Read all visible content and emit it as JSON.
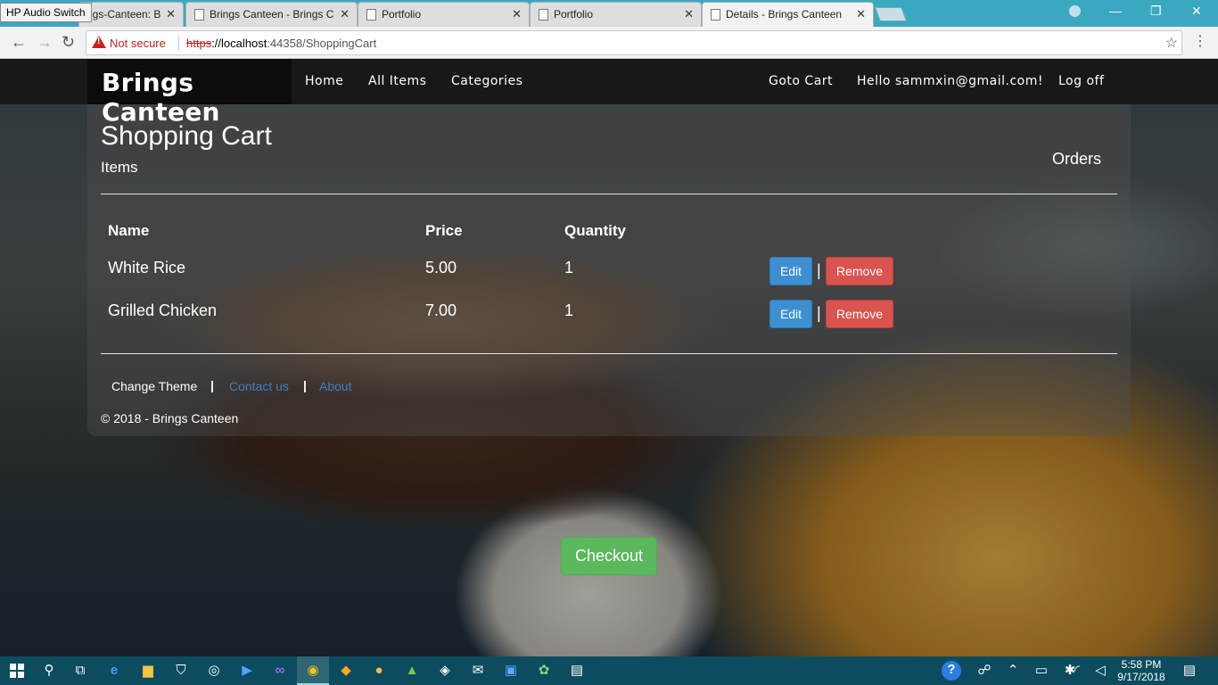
{
  "browser": {
    "hp_label": "HP Audio Switch",
    "tabs": [
      {
        "title": "ngs-Canteen: B",
        "active": false
      },
      {
        "title": "Brings Canteen - Brings C",
        "active": false
      },
      {
        "title": "Portfolio",
        "active": false
      },
      {
        "title": "Portfolio",
        "active": false
      },
      {
        "title": "Details - Brings Canteen",
        "active": true
      }
    ],
    "close_glyph": "✕",
    "security_label": "Not secure",
    "url_scheme": "https",
    "url_host": "://localhost",
    "url_rest": ":44358/ShoppingCart",
    "icons": [
      "back-icon",
      "forward-icon",
      "reload-icon",
      "warning-icon",
      "star-icon",
      "menu-icon"
    ]
  },
  "site": {
    "brand": "Brings Canteen",
    "nav_left": [
      "Home",
      "All Items",
      "Categories"
    ],
    "nav_right": [
      "Goto Cart",
      "Hello sammxin@gmail.com!",
      "Log off"
    ]
  },
  "cart": {
    "title": "Shopping Cart",
    "subtitle": "Items",
    "orders_link": "Orders",
    "columns": [
      "Name",
      "Price",
      "Quantity"
    ],
    "rows": [
      {
        "name": "White Rice",
        "price": "5.00",
        "quantity": "1"
      },
      {
        "name": "Grilled Chicken",
        "price": "7.00",
        "quantity": "1"
      }
    ],
    "edit_label": "Edit",
    "remove_label": "Remove",
    "divider": "|",
    "checkout_label": "Checkout"
  },
  "footer": {
    "links": [
      "Change Theme",
      "Contact us",
      "About"
    ],
    "separator": "|",
    "copyright": "© 2018 - Brings Canteen"
  },
  "taskbar": {
    "time": "5:58 PM",
    "date": "9/17/2018"
  },
  "colors": {
    "edit": "#3d8fd2",
    "remove": "#d9534f",
    "checkout": "#5cb85c",
    "link_blue": "#3b7fc4",
    "taskbar": "#0d4c5e",
    "tabstrip": "#3aa8c1"
  }
}
